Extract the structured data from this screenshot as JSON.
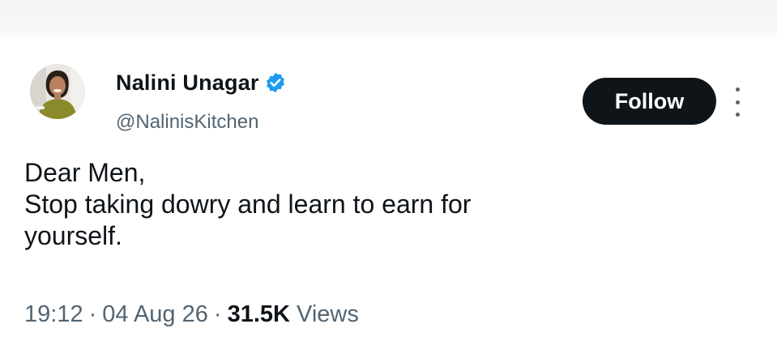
{
  "author": {
    "display_name": "Nalini Unagar",
    "handle": "@NalinisKitchen",
    "verified": true
  },
  "actions": {
    "follow_label": "Follow",
    "more_icon": "more-vertical-icon"
  },
  "tweet": {
    "lines": [
      "Dear Men,",
      "Stop taking dowry and learn to earn for",
      "yourself."
    ]
  },
  "meta": {
    "time": "19:12",
    "separator": "·",
    "date": "04 Aug 26",
    "views_count": "31.5K",
    "views_label": "Views"
  },
  "colors": {
    "verified_badge": "#1d9bf0",
    "follow_button_bg": "#0f1419",
    "secondary_text": "#536471"
  }
}
